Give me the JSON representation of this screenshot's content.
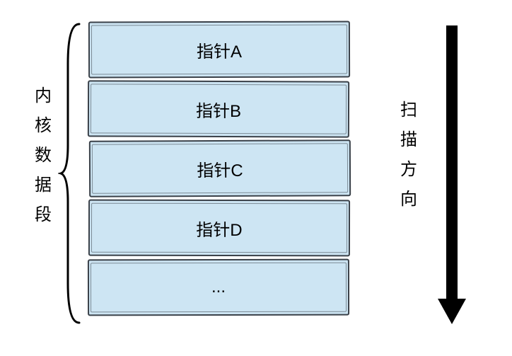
{
  "left_label": "内核数据段",
  "right_label": "扫描方向",
  "cells": {
    "0": "指针A",
    "1": "指针B",
    "2": "指针C",
    "3": "指针D",
    "4": "..."
  },
  "colors": {
    "cell_fill": "#cde5f3",
    "stroke": "#3a4149"
  }
}
